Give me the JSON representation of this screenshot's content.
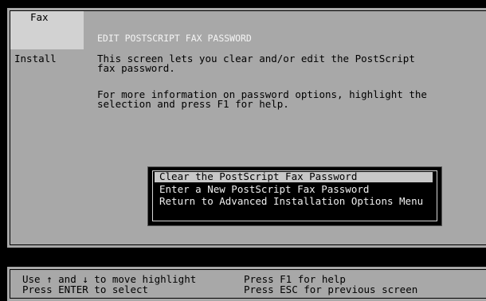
{
  "sidebar": {
    "fax_label": "Fax",
    "install_label": "Install"
  },
  "screen": {
    "title": "EDIT POSTSCRIPT FAX PASSWORD",
    "para1": "This screen lets you clear and/or edit the PostScript\nfax password.",
    "para2": "For more information on password options, highlight the\nselection and press F1 for help."
  },
  "menu": {
    "items": [
      {
        "label": "Clear the PostScript Fax Password",
        "selected": true
      },
      {
        "label": "Enter a New PostScript Fax Password",
        "selected": false
      },
      {
        "label": "Return to Advanced Installation Options Menu",
        "selected": false
      }
    ]
  },
  "status": {
    "nav_line1": "Use ↑ and ↓ to move highlight",
    "nav_line2": "Press ENTER to select",
    "help_line1": "Press F1 for help",
    "help_line2": "Press ESC for previous screen"
  },
  "colors": {
    "background": "#000000",
    "panel": "#a8a8a8",
    "highlight": "#c8c8c8",
    "title_text": "#f4f4f4"
  }
}
